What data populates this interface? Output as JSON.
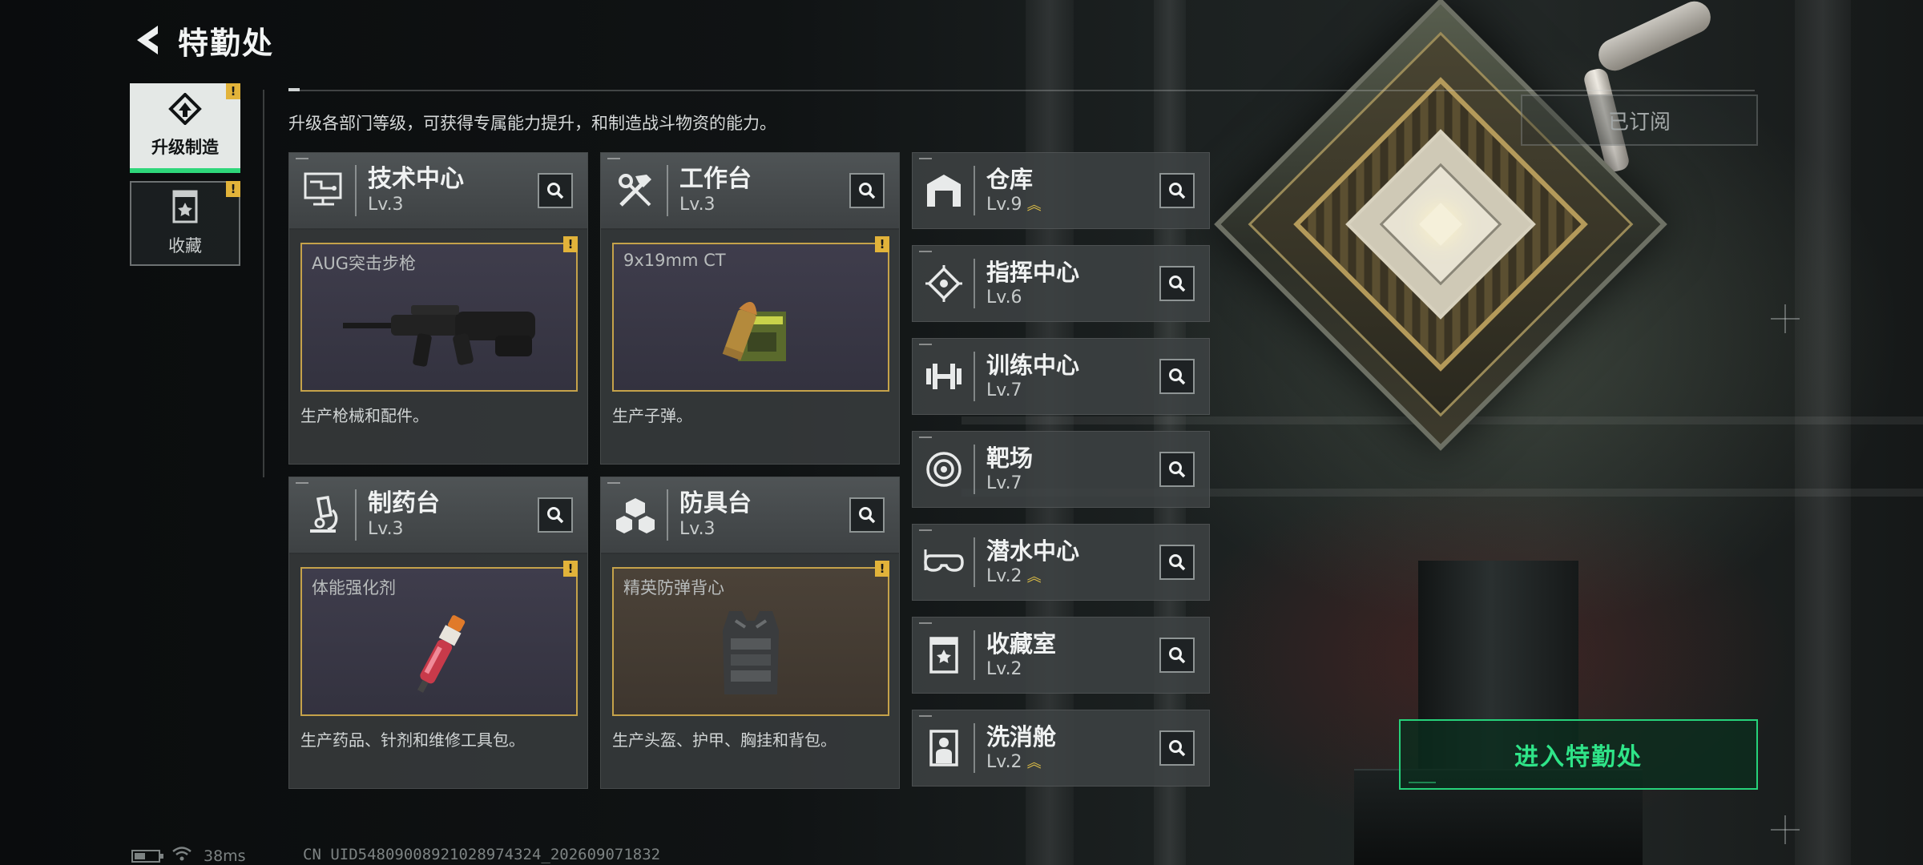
{
  "header": {
    "title": "特勤处"
  },
  "tabs": [
    {
      "label": "升级制造",
      "alert": "!",
      "active": true
    },
    {
      "label": "收藏",
      "alert": "!",
      "active": false
    }
  ],
  "description": "升级各部门等级，可获得专属能力提升，和制造战斗物资的能力。",
  "departments": [
    {
      "name": "技术中心",
      "level": "Lv.3",
      "product": "AUG突击步枪",
      "alert": "!",
      "desc": "生产枪械和配件。",
      "icon": "circuit-monitor-icon",
      "product_art": "assault-rifle"
    },
    {
      "name": "工作台",
      "level": "Lv.3",
      "product": "9x19mm CT",
      "alert": "!",
      "desc": "生产子弹。",
      "icon": "hammer-wrench-icon",
      "product_art": "ammo-box"
    },
    {
      "name": "制药台",
      "level": "Lv.3",
      "product": "体能强化剂",
      "alert": "!",
      "desc": "生产药品、针剂和维修工具包。",
      "icon": "microscope-icon",
      "product_art": "injector"
    },
    {
      "name": "防具台",
      "level": "Lv.3",
      "product": "精英防弹背心",
      "alert": "!",
      "desc": "生产头盔、护甲、胸挂和背包。",
      "icon": "cubes-icon",
      "product_art": "armor-vest"
    }
  ],
  "facilities": [
    {
      "name": "仓库",
      "level": "Lv.9",
      "upgrade": "︽",
      "icon": "warehouse-icon"
    },
    {
      "name": "指挥中心",
      "level": "Lv.6",
      "upgrade": "",
      "icon": "chip-icon"
    },
    {
      "name": "训练中心",
      "level": "Lv.7",
      "upgrade": "",
      "icon": "dumbbell-icon"
    },
    {
      "name": "靶场",
      "level": "Lv.7",
      "upgrade": "",
      "icon": "target-icon"
    },
    {
      "name": "潜水中心",
      "level": "Lv.2",
      "upgrade": "︽",
      "icon": "diving-mask-icon"
    },
    {
      "name": "收藏室",
      "level": "Lv.2",
      "upgrade": "",
      "icon": "display-case-icon"
    },
    {
      "name": "洗消舱",
      "level": "Lv.2",
      "upgrade": "︽",
      "icon": "decon-suit-icon"
    }
  ],
  "subscribed_label": "已订阅",
  "enter_button": "进入特勤处",
  "status": {
    "ping": "38ms",
    "uid": "CN UID5480900892102897432​4_202609071832"
  },
  "colors": {
    "accent_green": "#2fe488",
    "alert_yellow": "#e2b33a",
    "product_border": "#c5a24a"
  }
}
